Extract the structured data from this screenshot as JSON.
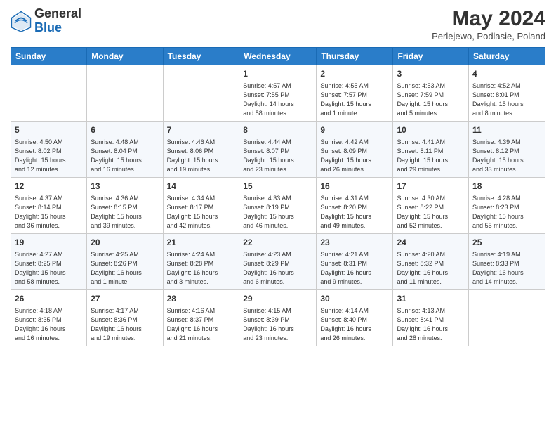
{
  "header": {
    "logo_general": "General",
    "logo_blue": "Blue",
    "month_title": "May 2024",
    "location": "Perlejewo, Podlasie, Poland"
  },
  "days_of_week": [
    "Sunday",
    "Monday",
    "Tuesday",
    "Wednesday",
    "Thursday",
    "Friday",
    "Saturday"
  ],
  "weeks": [
    [
      {
        "day": "",
        "info": ""
      },
      {
        "day": "",
        "info": ""
      },
      {
        "day": "",
        "info": ""
      },
      {
        "day": "1",
        "info": "Sunrise: 4:57 AM\nSunset: 7:55 PM\nDaylight: 14 hours\nand 58 minutes."
      },
      {
        "day": "2",
        "info": "Sunrise: 4:55 AM\nSunset: 7:57 PM\nDaylight: 15 hours\nand 1 minute."
      },
      {
        "day": "3",
        "info": "Sunrise: 4:53 AM\nSunset: 7:59 PM\nDaylight: 15 hours\nand 5 minutes."
      },
      {
        "day": "4",
        "info": "Sunrise: 4:52 AM\nSunset: 8:01 PM\nDaylight: 15 hours\nand 8 minutes."
      }
    ],
    [
      {
        "day": "5",
        "info": "Sunrise: 4:50 AM\nSunset: 8:02 PM\nDaylight: 15 hours\nand 12 minutes."
      },
      {
        "day": "6",
        "info": "Sunrise: 4:48 AM\nSunset: 8:04 PM\nDaylight: 15 hours\nand 16 minutes."
      },
      {
        "day": "7",
        "info": "Sunrise: 4:46 AM\nSunset: 8:06 PM\nDaylight: 15 hours\nand 19 minutes."
      },
      {
        "day": "8",
        "info": "Sunrise: 4:44 AM\nSunset: 8:07 PM\nDaylight: 15 hours\nand 23 minutes."
      },
      {
        "day": "9",
        "info": "Sunrise: 4:42 AM\nSunset: 8:09 PM\nDaylight: 15 hours\nand 26 minutes."
      },
      {
        "day": "10",
        "info": "Sunrise: 4:41 AM\nSunset: 8:11 PM\nDaylight: 15 hours\nand 29 minutes."
      },
      {
        "day": "11",
        "info": "Sunrise: 4:39 AM\nSunset: 8:12 PM\nDaylight: 15 hours\nand 33 minutes."
      }
    ],
    [
      {
        "day": "12",
        "info": "Sunrise: 4:37 AM\nSunset: 8:14 PM\nDaylight: 15 hours\nand 36 minutes."
      },
      {
        "day": "13",
        "info": "Sunrise: 4:36 AM\nSunset: 8:15 PM\nDaylight: 15 hours\nand 39 minutes."
      },
      {
        "day": "14",
        "info": "Sunrise: 4:34 AM\nSunset: 8:17 PM\nDaylight: 15 hours\nand 42 minutes."
      },
      {
        "day": "15",
        "info": "Sunrise: 4:33 AM\nSunset: 8:19 PM\nDaylight: 15 hours\nand 46 minutes."
      },
      {
        "day": "16",
        "info": "Sunrise: 4:31 AM\nSunset: 8:20 PM\nDaylight: 15 hours\nand 49 minutes."
      },
      {
        "day": "17",
        "info": "Sunrise: 4:30 AM\nSunset: 8:22 PM\nDaylight: 15 hours\nand 52 minutes."
      },
      {
        "day": "18",
        "info": "Sunrise: 4:28 AM\nSunset: 8:23 PM\nDaylight: 15 hours\nand 55 minutes."
      }
    ],
    [
      {
        "day": "19",
        "info": "Sunrise: 4:27 AM\nSunset: 8:25 PM\nDaylight: 15 hours\nand 58 minutes."
      },
      {
        "day": "20",
        "info": "Sunrise: 4:25 AM\nSunset: 8:26 PM\nDaylight: 16 hours\nand 1 minute."
      },
      {
        "day": "21",
        "info": "Sunrise: 4:24 AM\nSunset: 8:28 PM\nDaylight: 16 hours\nand 3 minutes."
      },
      {
        "day": "22",
        "info": "Sunrise: 4:23 AM\nSunset: 8:29 PM\nDaylight: 16 hours\nand 6 minutes."
      },
      {
        "day": "23",
        "info": "Sunrise: 4:21 AM\nSunset: 8:31 PM\nDaylight: 16 hours\nand 9 minutes."
      },
      {
        "day": "24",
        "info": "Sunrise: 4:20 AM\nSunset: 8:32 PM\nDaylight: 16 hours\nand 11 minutes."
      },
      {
        "day": "25",
        "info": "Sunrise: 4:19 AM\nSunset: 8:33 PM\nDaylight: 16 hours\nand 14 minutes."
      }
    ],
    [
      {
        "day": "26",
        "info": "Sunrise: 4:18 AM\nSunset: 8:35 PM\nDaylight: 16 hours\nand 16 minutes."
      },
      {
        "day": "27",
        "info": "Sunrise: 4:17 AM\nSunset: 8:36 PM\nDaylight: 16 hours\nand 19 minutes."
      },
      {
        "day": "28",
        "info": "Sunrise: 4:16 AM\nSunset: 8:37 PM\nDaylight: 16 hours\nand 21 minutes."
      },
      {
        "day": "29",
        "info": "Sunrise: 4:15 AM\nSunset: 8:39 PM\nDaylight: 16 hours\nand 23 minutes."
      },
      {
        "day": "30",
        "info": "Sunrise: 4:14 AM\nSunset: 8:40 PM\nDaylight: 16 hours\nand 26 minutes."
      },
      {
        "day": "31",
        "info": "Sunrise: 4:13 AM\nSunset: 8:41 PM\nDaylight: 16 hours\nand 28 minutes."
      },
      {
        "day": "",
        "info": ""
      }
    ]
  ]
}
